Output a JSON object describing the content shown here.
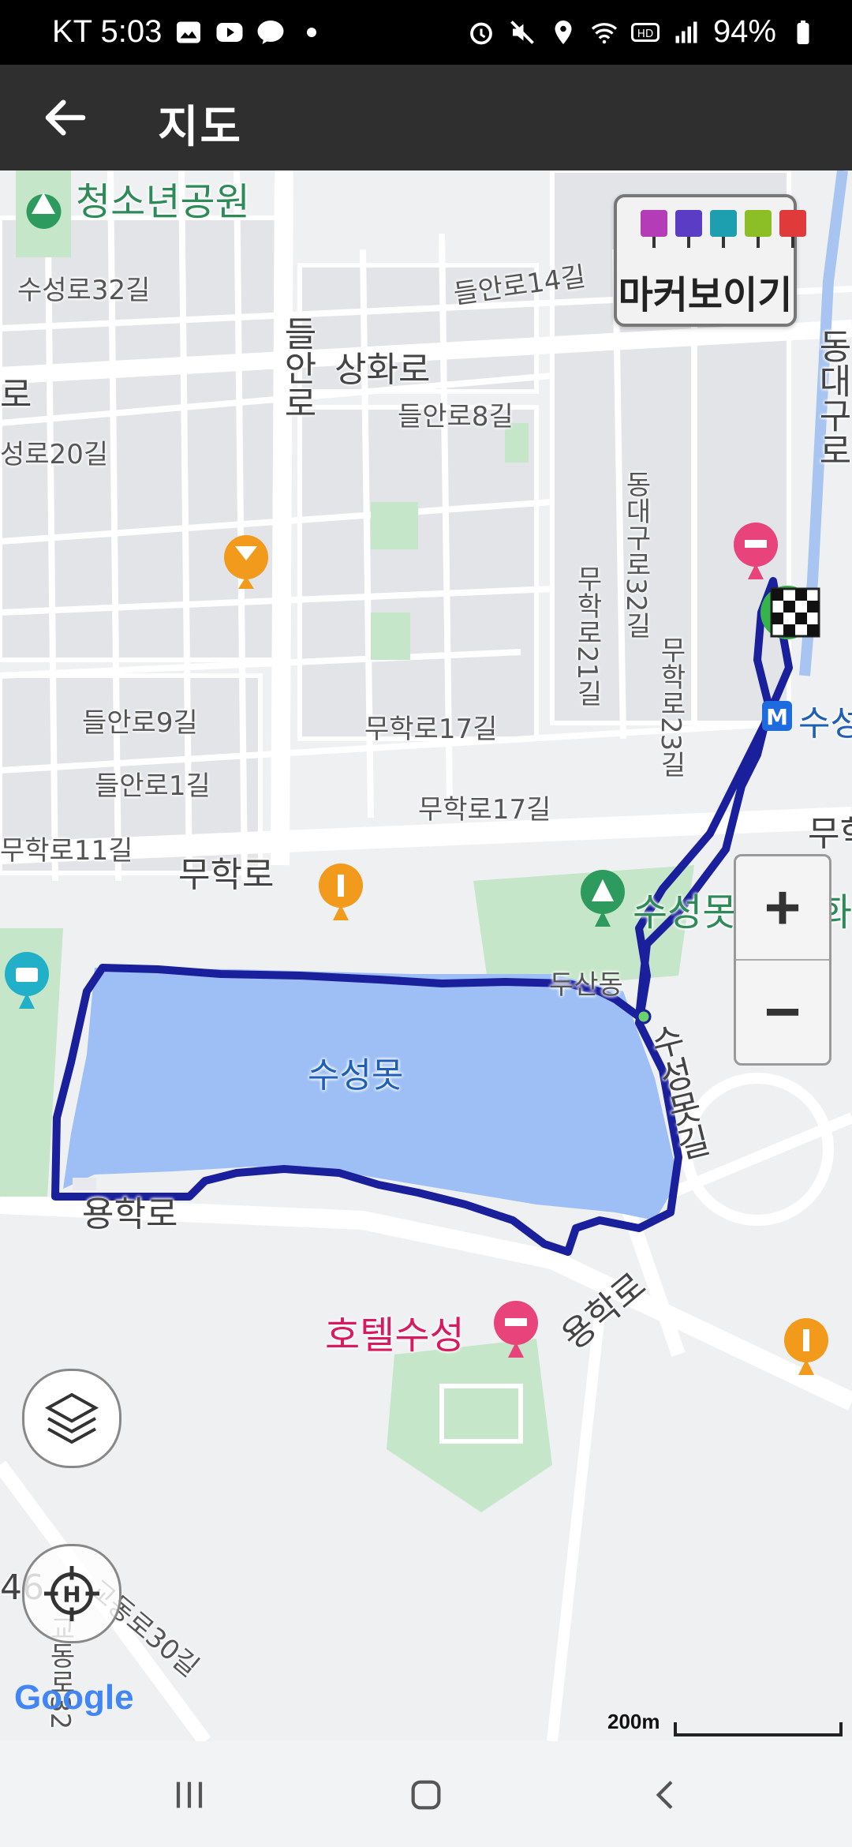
{
  "status_bar": {
    "carrier_time": "KT 5:03",
    "battery": "94%"
  },
  "header": {
    "title": "지도"
  },
  "map": {
    "labels": {
      "youth_park": "청소년공원",
      "suseong32": "수성로32길",
      "deulan14": "들안로14길",
      "deulan_ro": "들안로",
      "sanghwa_ro": "상화로",
      "ro_left": "로",
      "deulan8": "들안로8길",
      "suseong20": "성로20길",
      "donggu_ro": "동대구로",
      "dongdae32": "동대구로32길",
      "muhak21": "무학로21길",
      "muhak23": "무학로23길",
      "deulan9": "들안로9길",
      "muhak17a": "무학로17길",
      "deulan1": "들안로1길",
      "muhak17b": "무학로17길",
      "muhak11": "무학로11길",
      "muhak_ro": "무학로",
      "muhak_right": "무학",
      "suseongmot_park": "수성못",
      "park_suffix": "화",
      "dusan_dong": "두산동",
      "suseongmot_gil": "수성못길",
      "lake_name": "수성못",
      "yonghak_ro": "용학로",
      "yonghak_ro2": "용학로",
      "hotel": "호텔수성",
      "subway": "수성",
      "gyo30": "교동로30길",
      "left_num": "46",
      "gyo32": "교동로32"
    },
    "marker_toggle_label": "마커보이기",
    "zoom_in": "+",
    "zoom_out": "−",
    "google_logo": "Google",
    "scale_label": "200m"
  },
  "colors": {
    "route": "#1a1f9c",
    "lake": "#9dbff5",
    "park": "#c5e6c8",
    "accent_green": "#2e8b57",
    "hotel_pink": "#d81b60"
  }
}
